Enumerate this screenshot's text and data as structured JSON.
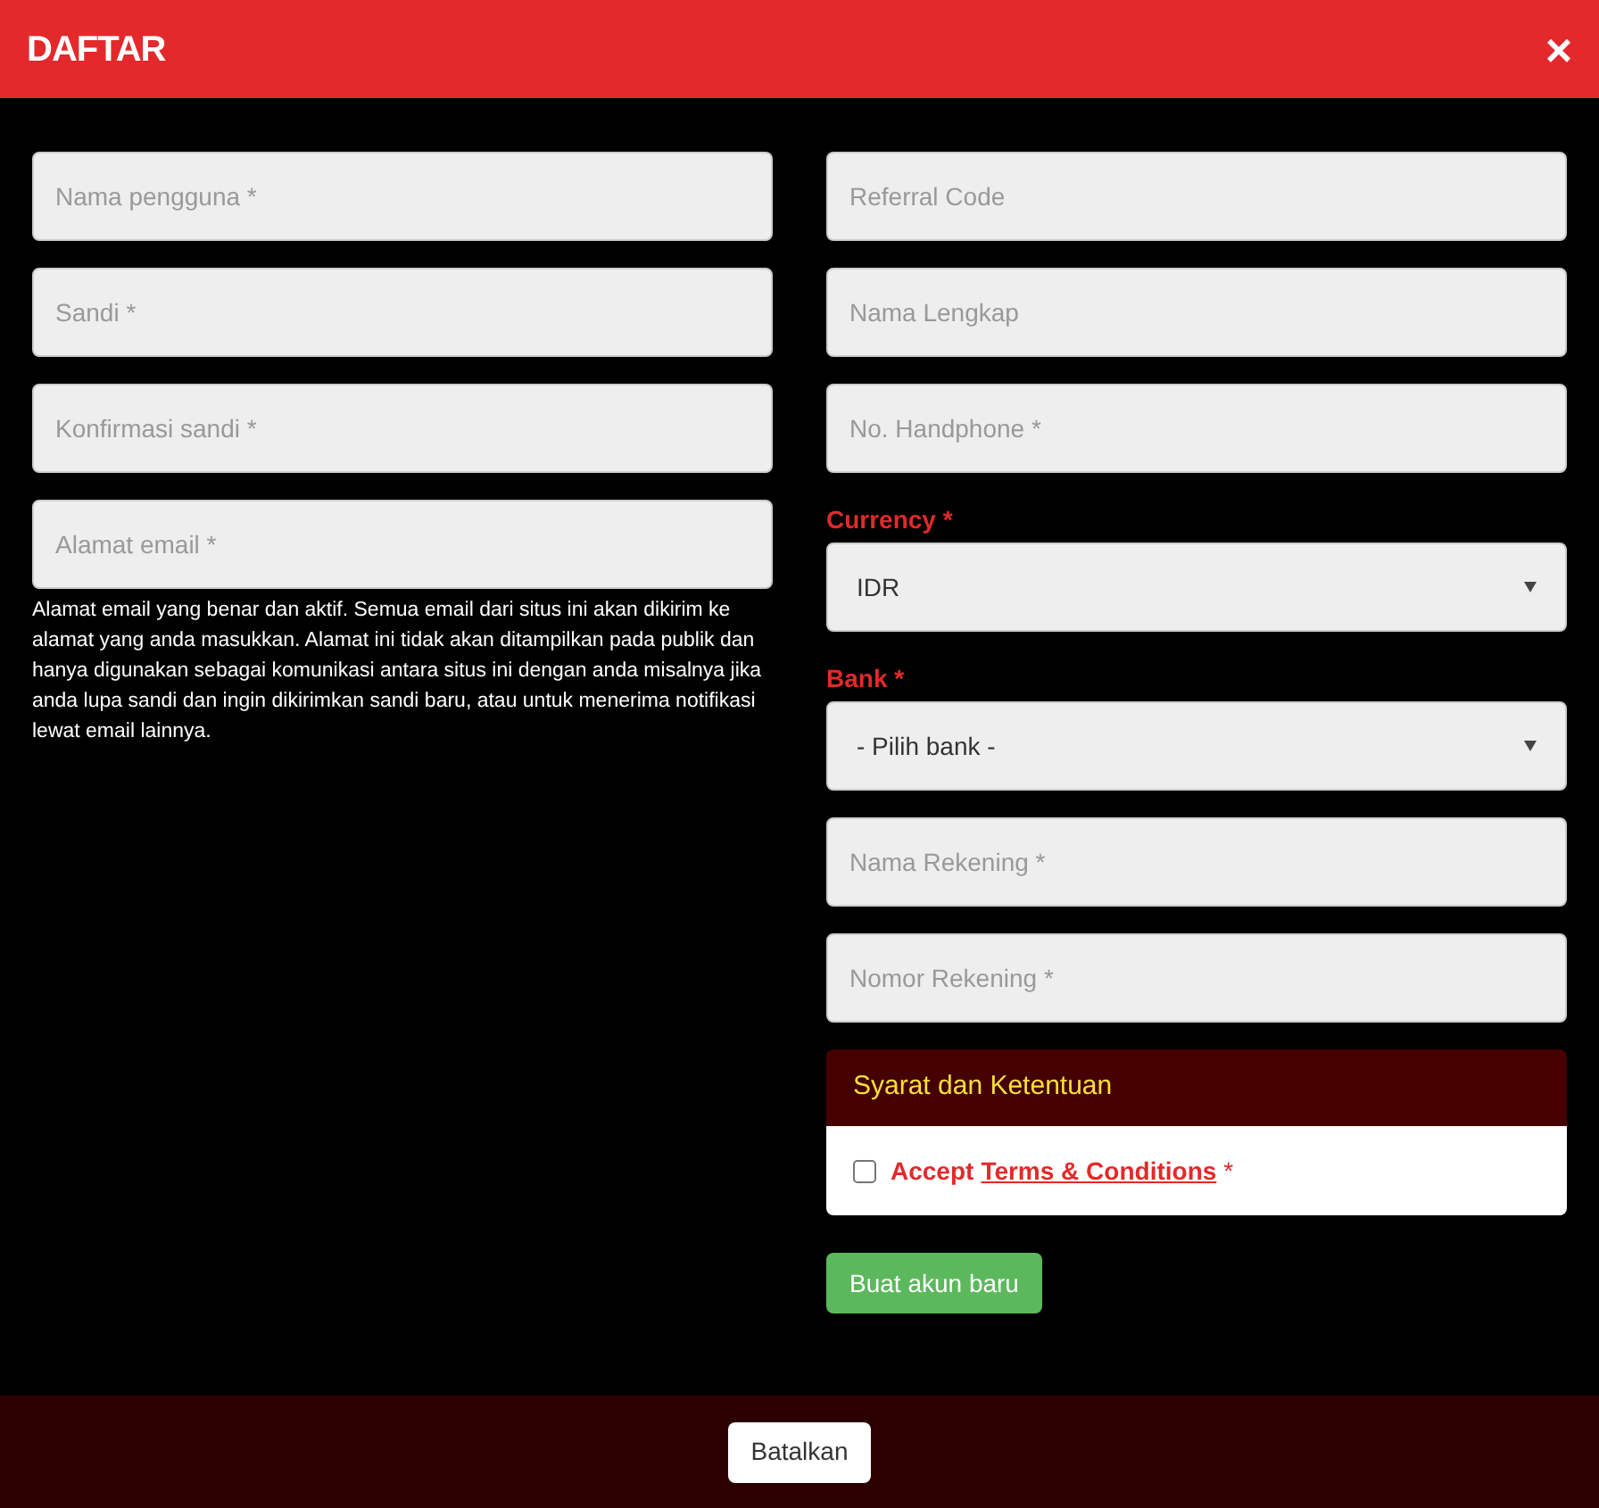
{
  "dialog": {
    "title": "DAFTAR",
    "close": "×"
  },
  "left_fields": [
    {
      "placeholder": "Nama pengguna *"
    },
    {
      "placeholder": "Sandi *"
    },
    {
      "placeholder": "Konfirmasi sandi *"
    },
    {
      "placeholder": "Alamat email *"
    }
  ],
  "email_hint": "Alamat email yang benar dan aktif. Semua email dari situs ini akan dikirim ke alamat yang anda masukkan. Alamat ini tidak akan ditampilkan pada publik dan hanya digunakan sebagai komunikasi antara situs ini dengan anda misalnya jika anda lupa sandi dan ingin dikirimkan sandi baru, atau untuk menerima notifikasi lewat email lainnya.",
  "right_fields": [
    {
      "kind": "input",
      "placeholder": "Referral Code"
    },
    {
      "kind": "input",
      "placeholder": "Nama Lengkap"
    },
    {
      "kind": "input",
      "placeholder": "No. Handphone *"
    },
    {
      "kind": "select",
      "label": "Currency *",
      "value": "IDR"
    },
    {
      "kind": "select",
      "label": "Bank *",
      "value": "- Pilih bank -"
    },
    {
      "kind": "input",
      "placeholder": "Nama Rekening *"
    },
    {
      "kind": "input",
      "placeholder": "Nomor Rekening *"
    }
  ],
  "terms": {
    "title": "Syarat dan Ketentuan",
    "checked": false,
    "accept": "Accept",
    "link": "Terms & Conditions",
    "required": "*"
  },
  "submit_button": "Buat akun baru",
  "cancel_button": "Batalkan"
}
